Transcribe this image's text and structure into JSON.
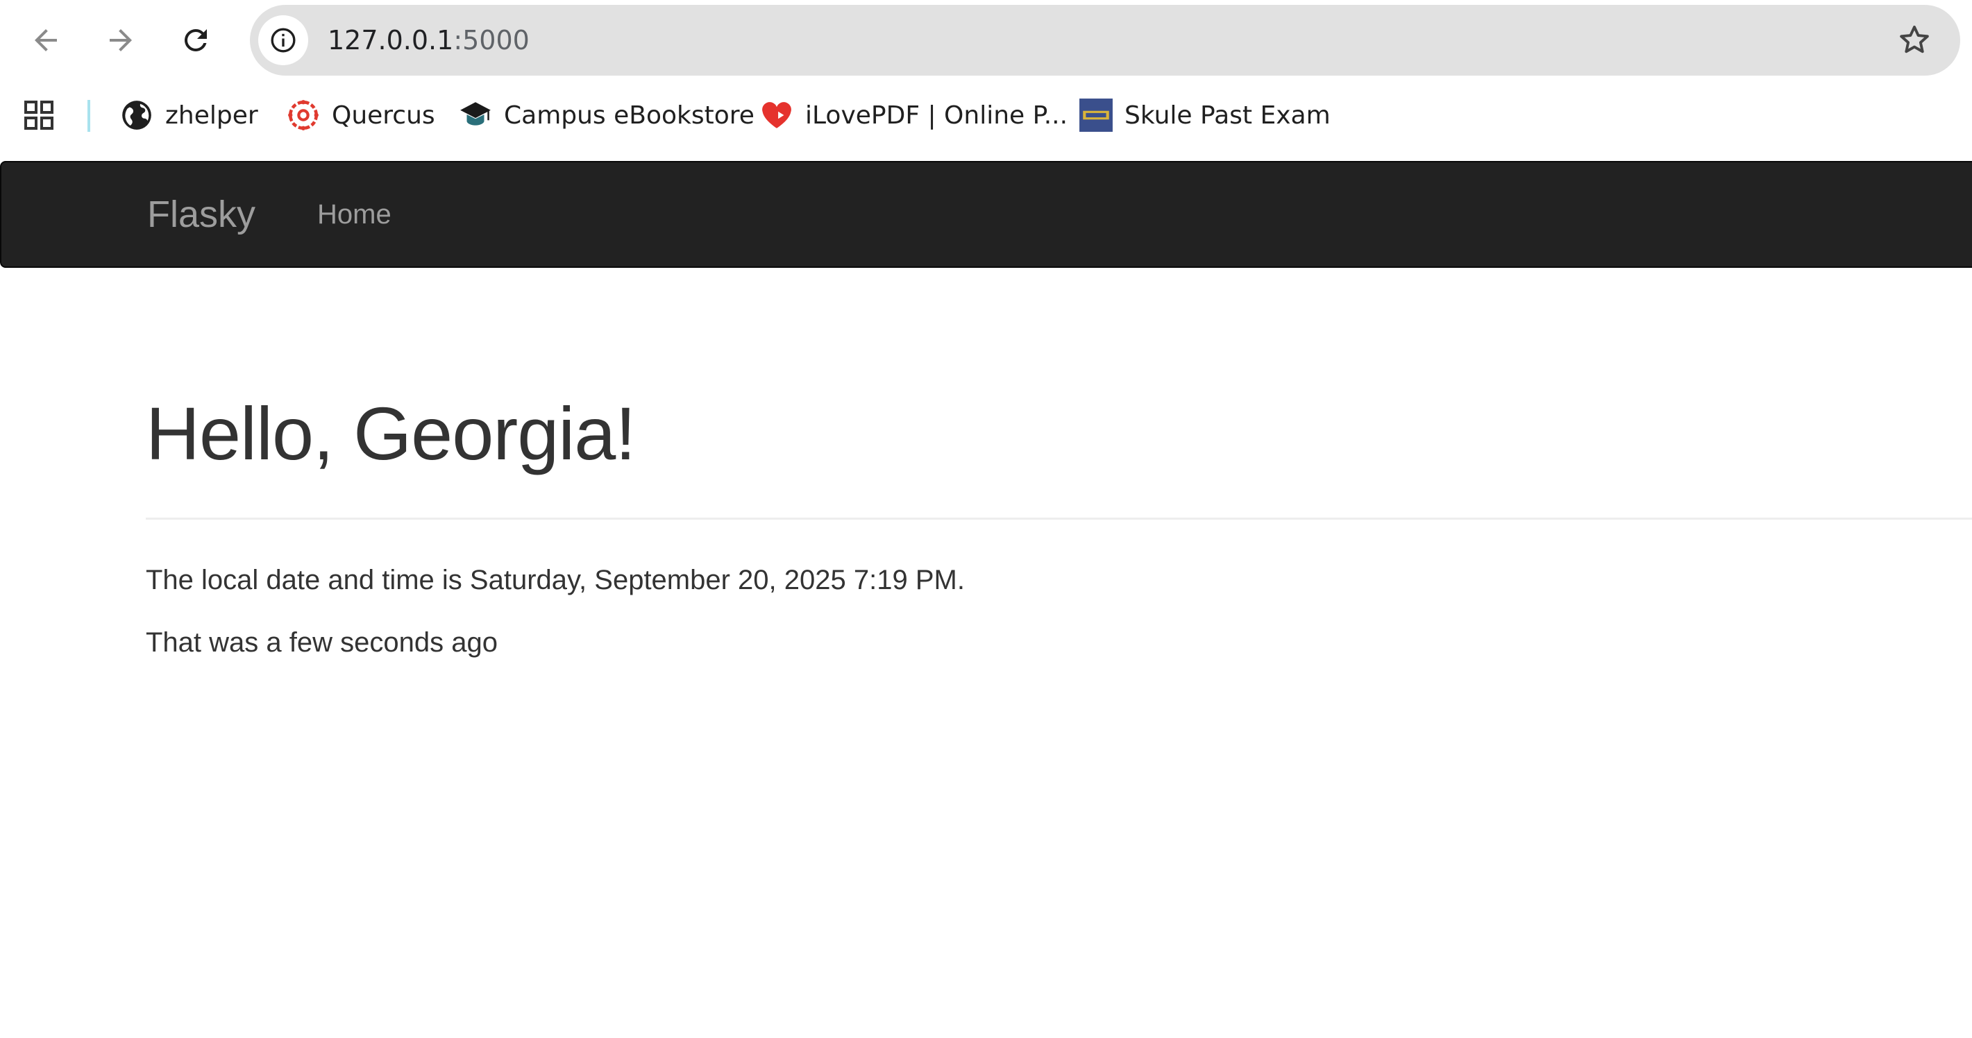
{
  "browser": {
    "address": {
      "host": "127.0.0.1",
      "port": ":5000"
    },
    "bookmarks": [
      {
        "label": "zhelper",
        "icon": "globe-icon"
      },
      {
        "label": "Quercus",
        "icon": "quercus-logo-icon"
      },
      {
        "label": "Campus eBookstore",
        "icon": "graduation-cap-icon"
      },
      {
        "label": "iLovePDF | Online P...",
        "icon": "heart-icon"
      },
      {
        "label": "Skule Past Exam",
        "icon": "skule-logo-icon"
      }
    ]
  },
  "navbar": {
    "brand": "Flasky",
    "links": [
      "Home"
    ]
  },
  "main": {
    "heading": "Hello, Georgia!",
    "local_time_text": "The local date and time is Saturday, September 20, 2025 7:19 PM.",
    "relative_time_text": "That was a few seconds ago"
  },
  "colors": {
    "navbar_bg": "#222222",
    "navbar_text": "#9d9d9d",
    "body_text": "#333333",
    "omnibox_bg": "#e1e1e1"
  }
}
